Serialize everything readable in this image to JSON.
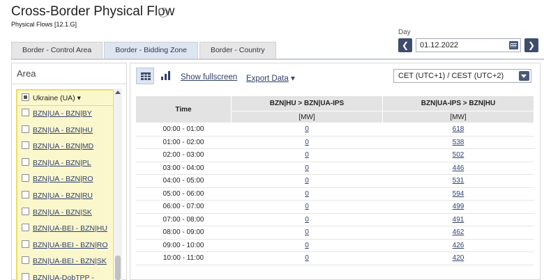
{
  "page": {
    "title": "Cross-Border Physical Flow",
    "help_icon": "?",
    "subtitle": "Physical Flows [12.1.G]"
  },
  "tabs": [
    {
      "label": "Border - Control Area",
      "active": false
    },
    {
      "label": "Border - Bidding Zone",
      "active": true
    },
    {
      "label": "Border - Country",
      "active": false
    }
  ],
  "day": {
    "label": "Day",
    "value": "01.12.2022",
    "prev_icon": "chevron-left-icon",
    "next_icon": "chevron-right-icon"
  },
  "area": {
    "header": "Area",
    "group": "Ukraine (UA)",
    "group_arrow": "▾",
    "items": [
      "BZN|UA - BZN|BY",
      "BZN|UA - BZN|HU",
      "BZN|UA - BZN|MD",
      "BZN|UA - BZN|PL",
      "BZN|UA - BZN|RO",
      "BZN|UA - BZN|RU",
      "BZN|UA - BZN|SK",
      "BZN|UA-BEI - BZN|HU",
      "BZN|UA-BEI - BZN|RO",
      "BZN|UA-BEI - BZN|SK",
      "BZN|UA-DobTPP -"
    ]
  },
  "toolbar": {
    "show_fullscreen": "Show fullscreen",
    "export_data": "Export Data",
    "export_arrow": "▾",
    "timezone": "CET (UTC+1) / CEST (UTC+2)"
  },
  "table": {
    "time_header": "Time",
    "columns": [
      {
        "header": "BZN|HU > BZN|UA-IPS",
        "unit": "[MW]"
      },
      {
        "header": "BZN|UA-IPS > BZN|HU",
        "unit": "[MW]"
      }
    ],
    "rows": [
      {
        "time": "00:00 - 01:00",
        "a": "0",
        "b": "618"
      },
      {
        "time": "01:00 - 02:00",
        "a": "0",
        "b": "538"
      },
      {
        "time": "02:00 - 03:00",
        "a": "0",
        "b": "502"
      },
      {
        "time": "03:00 - 04:00",
        "a": "0",
        "b": "446"
      },
      {
        "time": "04:00 - 05:00",
        "a": "0",
        "b": "531"
      },
      {
        "time": "05:00 - 06:00",
        "a": "0",
        "b": "594"
      },
      {
        "time": "06:00 - 07:00",
        "a": "0",
        "b": "499"
      },
      {
        "time": "07:00 - 08:00",
        "a": "0",
        "b": "491"
      },
      {
        "time": "08:00 - 09:00",
        "a": "0",
        "b": "462"
      },
      {
        "time": "09:00 - 10:00",
        "a": "0",
        "b": "426"
      },
      {
        "time": "10:00 - 11:00",
        "a": "0",
        "b": "420"
      }
    ]
  },
  "colors": {
    "accent": "#3e4d6b",
    "link": "#2e3f6b",
    "area_highlight": "#fbf7cd",
    "area_border": "#e9df62"
  }
}
